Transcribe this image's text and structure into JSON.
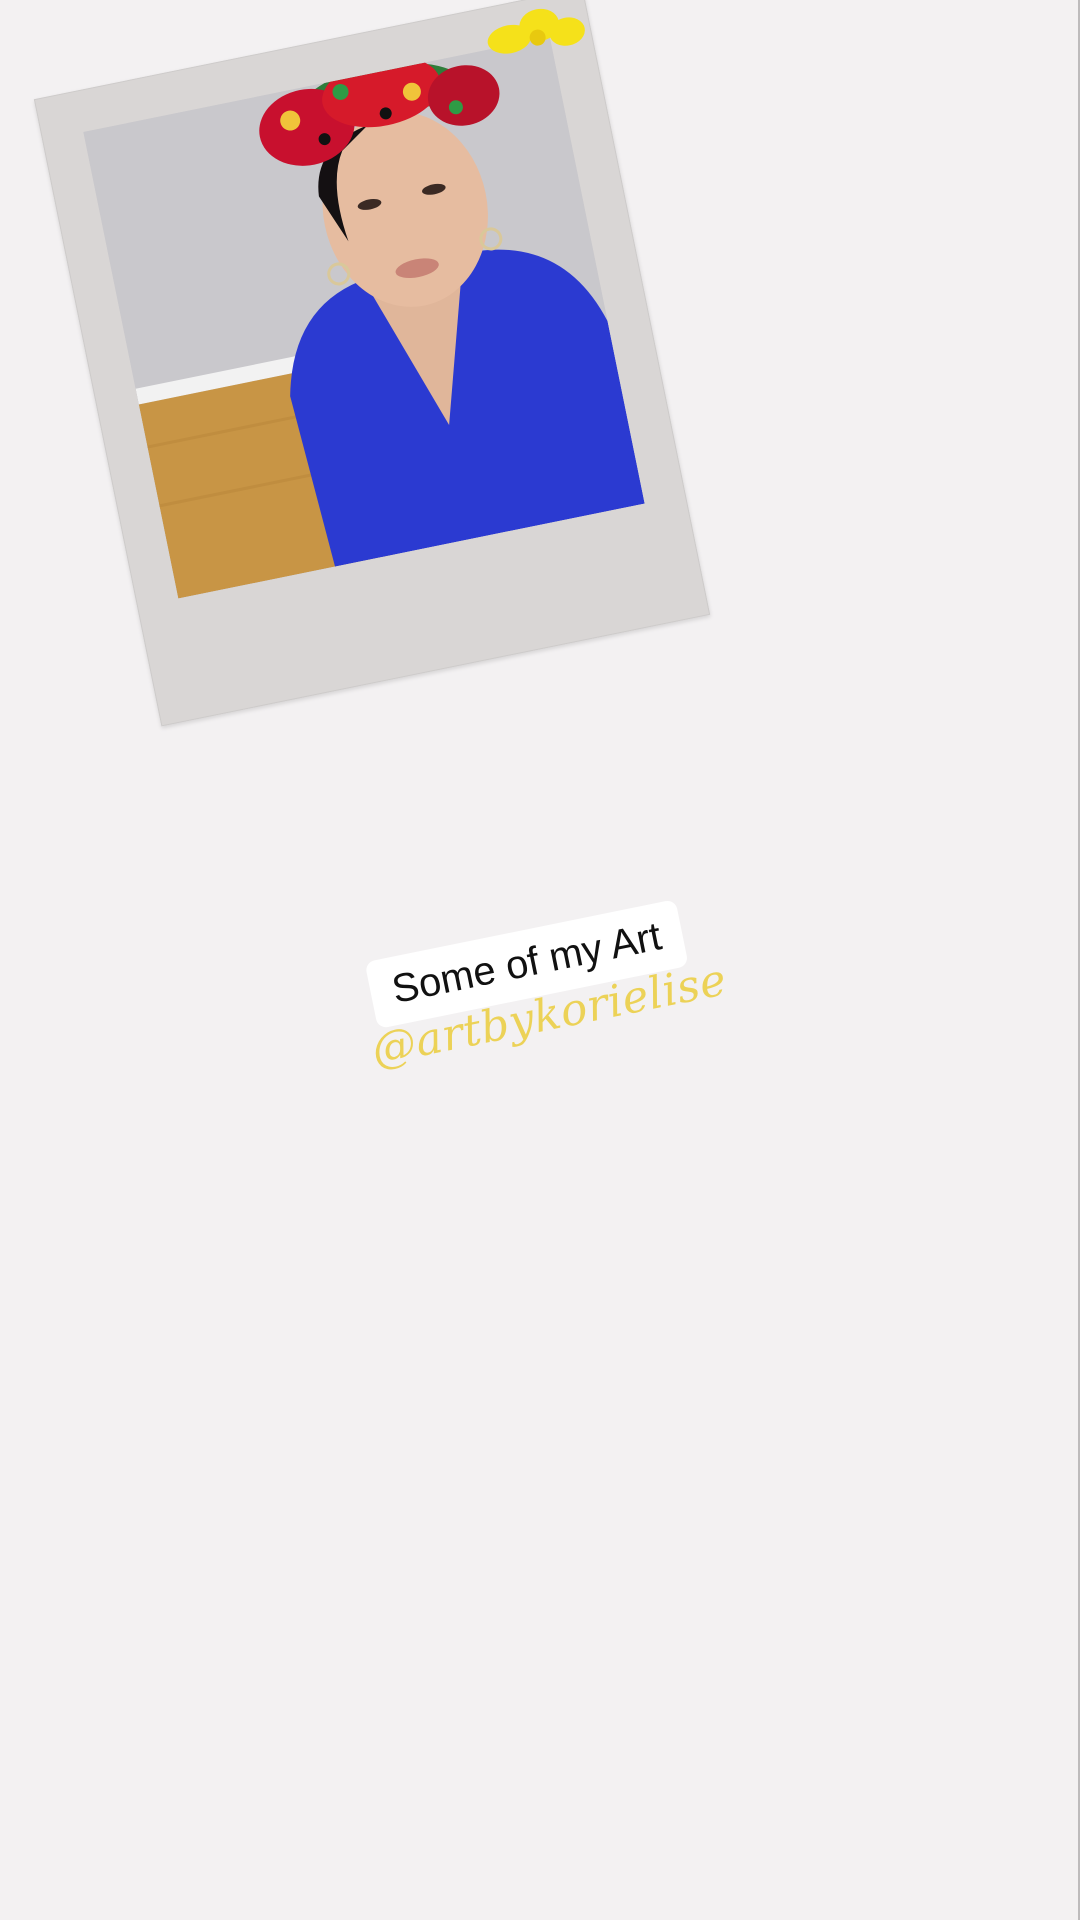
{
  "story": {
    "caption": "Some of my Art",
    "handle": "@artbykorielise"
  },
  "colors": {
    "background": "#f3f1f2",
    "frame": "#d9d6d5",
    "caption_bg": "#ffffff",
    "caption_text": "#111111",
    "handle_text": "#ecd257",
    "sticker": "#f5e11a"
  },
  "stickers": {
    "flower_icon": "flower-sticker-icon"
  }
}
